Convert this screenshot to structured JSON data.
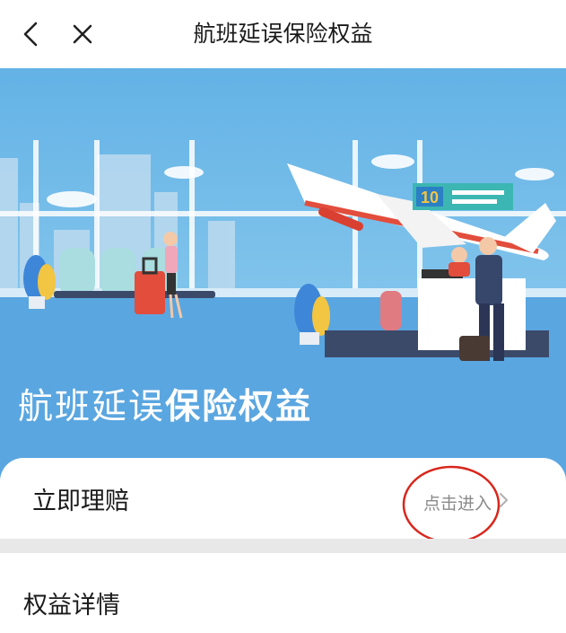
{
  "header": {
    "title": "航班延误保险权益",
    "back_icon": "chevron-left-icon",
    "close_icon": "close-icon"
  },
  "banner": {
    "title_regular": "航班延误",
    "title_bold": "保险权益",
    "gate_sign_number": "10",
    "colors": {
      "sky": "#7cc4ec",
      "floor": "#5aa6e0",
      "accent": "#e24d3c"
    }
  },
  "claim": {
    "title": "立即理赔",
    "enter_label": "点击进入",
    "chevron_icon": "chevron-right-icon",
    "highlight_color": "#d9261c"
  },
  "details": {
    "title": "权益详情"
  }
}
